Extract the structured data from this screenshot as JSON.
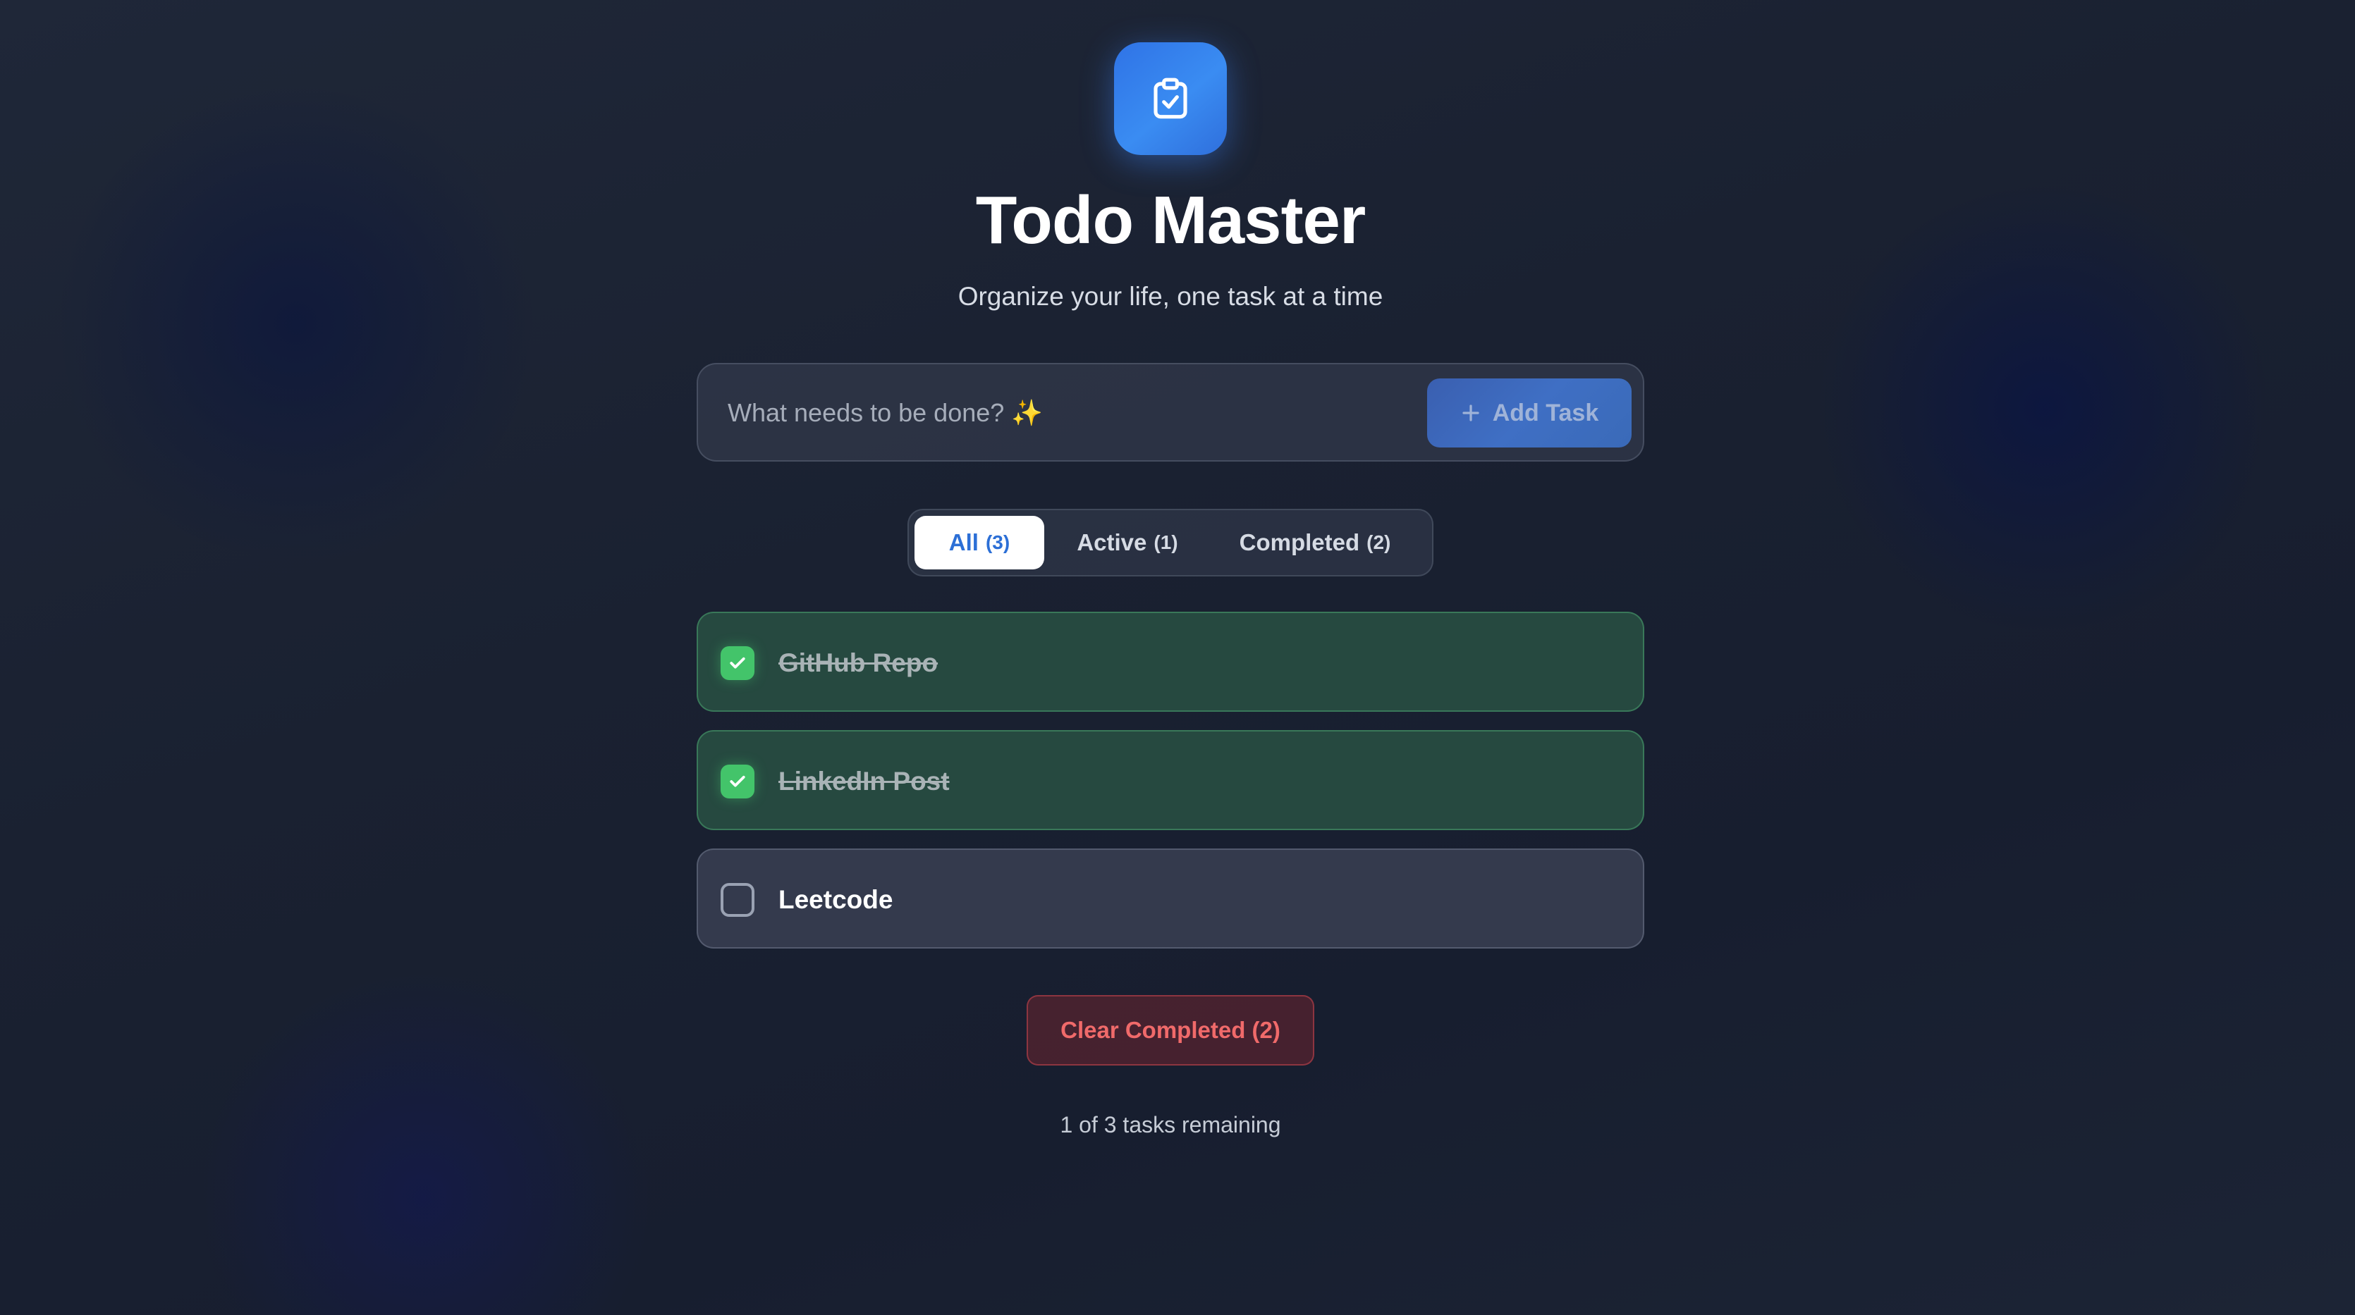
{
  "header": {
    "logo_icon": "clipboard-check-icon",
    "title": "Todo Master",
    "subtitle": "Organize your life, one task at a time"
  },
  "add_form": {
    "placeholder": "What needs to be done? ✨",
    "value": "",
    "button_label": "Add Task",
    "button_icon": "plus-icon"
  },
  "filters": {
    "tabs": [
      {
        "label": "All",
        "count": "(3)",
        "selected": true
      },
      {
        "label": "Active",
        "count": "(1)",
        "selected": false
      },
      {
        "label": "Completed",
        "count": "(2)",
        "selected": false
      }
    ]
  },
  "todos": [
    {
      "text": "GitHub Repo",
      "completed": true
    },
    {
      "text": "LinkedIn Post",
      "completed": true
    },
    {
      "text": "Leetcode",
      "completed": false
    }
  ],
  "footer": {
    "clear_label": "Clear Completed (2)",
    "remaining_text": "1 of 3 tasks remaining"
  },
  "colors": {
    "accent": "#3b82f6",
    "done_green": "#43c46a",
    "danger": "#f06a6a",
    "background": "#1a2233"
  }
}
